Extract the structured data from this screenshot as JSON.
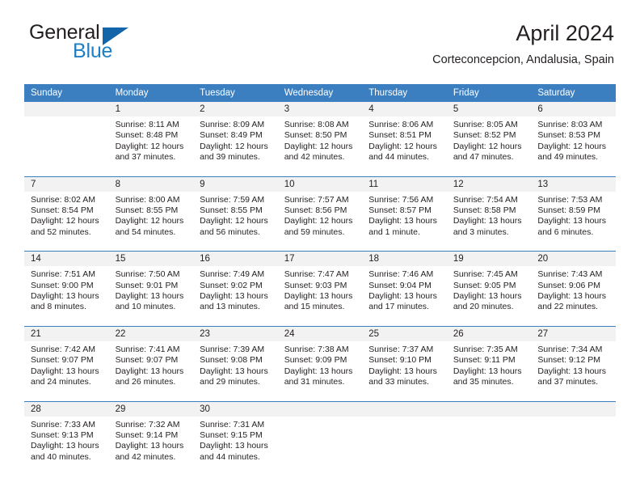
{
  "brand": {
    "name_part1": "General",
    "name_part2": "Blue",
    "triangle_color": "#1265a8",
    "blue_color": "#1f7fc4"
  },
  "header": {
    "title": "April 2024",
    "subtitle": "Corteconcepcion, Andalusia, Spain"
  },
  "theme": {
    "header_bg": "#3b7fc0",
    "daynum_bg": "#f2f2f2",
    "text": "#231f20"
  },
  "weekdays": [
    "Sunday",
    "Monday",
    "Tuesday",
    "Wednesday",
    "Thursday",
    "Friday",
    "Saturday"
  ],
  "weeks": [
    {
      "days": [
        {
          "num": "",
          "sunrise": "",
          "sunset": "",
          "daylight1": "",
          "daylight2": ""
        },
        {
          "num": "1",
          "sunrise": "Sunrise: 8:11 AM",
          "sunset": "Sunset: 8:48 PM",
          "daylight1": "Daylight: 12 hours",
          "daylight2": "and 37 minutes."
        },
        {
          "num": "2",
          "sunrise": "Sunrise: 8:09 AM",
          "sunset": "Sunset: 8:49 PM",
          "daylight1": "Daylight: 12 hours",
          "daylight2": "and 39 minutes."
        },
        {
          "num": "3",
          "sunrise": "Sunrise: 8:08 AM",
          "sunset": "Sunset: 8:50 PM",
          "daylight1": "Daylight: 12 hours",
          "daylight2": "and 42 minutes."
        },
        {
          "num": "4",
          "sunrise": "Sunrise: 8:06 AM",
          "sunset": "Sunset: 8:51 PM",
          "daylight1": "Daylight: 12 hours",
          "daylight2": "and 44 minutes."
        },
        {
          "num": "5",
          "sunrise": "Sunrise: 8:05 AM",
          "sunset": "Sunset: 8:52 PM",
          "daylight1": "Daylight: 12 hours",
          "daylight2": "and 47 minutes."
        },
        {
          "num": "6",
          "sunrise": "Sunrise: 8:03 AM",
          "sunset": "Sunset: 8:53 PM",
          "daylight1": "Daylight: 12 hours",
          "daylight2": "and 49 minutes."
        }
      ]
    },
    {
      "days": [
        {
          "num": "7",
          "sunrise": "Sunrise: 8:02 AM",
          "sunset": "Sunset: 8:54 PM",
          "daylight1": "Daylight: 12 hours",
          "daylight2": "and 52 minutes."
        },
        {
          "num": "8",
          "sunrise": "Sunrise: 8:00 AM",
          "sunset": "Sunset: 8:55 PM",
          "daylight1": "Daylight: 12 hours",
          "daylight2": "and 54 minutes."
        },
        {
          "num": "9",
          "sunrise": "Sunrise: 7:59 AM",
          "sunset": "Sunset: 8:55 PM",
          "daylight1": "Daylight: 12 hours",
          "daylight2": "and 56 minutes."
        },
        {
          "num": "10",
          "sunrise": "Sunrise: 7:57 AM",
          "sunset": "Sunset: 8:56 PM",
          "daylight1": "Daylight: 12 hours",
          "daylight2": "and 59 minutes."
        },
        {
          "num": "11",
          "sunrise": "Sunrise: 7:56 AM",
          "sunset": "Sunset: 8:57 PM",
          "daylight1": "Daylight: 13 hours",
          "daylight2": "and 1 minute."
        },
        {
          "num": "12",
          "sunrise": "Sunrise: 7:54 AM",
          "sunset": "Sunset: 8:58 PM",
          "daylight1": "Daylight: 13 hours",
          "daylight2": "and 3 minutes."
        },
        {
          "num": "13",
          "sunrise": "Sunrise: 7:53 AM",
          "sunset": "Sunset: 8:59 PM",
          "daylight1": "Daylight: 13 hours",
          "daylight2": "and 6 minutes."
        }
      ]
    },
    {
      "days": [
        {
          "num": "14",
          "sunrise": "Sunrise: 7:51 AM",
          "sunset": "Sunset: 9:00 PM",
          "daylight1": "Daylight: 13 hours",
          "daylight2": "and 8 minutes."
        },
        {
          "num": "15",
          "sunrise": "Sunrise: 7:50 AM",
          "sunset": "Sunset: 9:01 PM",
          "daylight1": "Daylight: 13 hours",
          "daylight2": "and 10 minutes."
        },
        {
          "num": "16",
          "sunrise": "Sunrise: 7:49 AM",
          "sunset": "Sunset: 9:02 PM",
          "daylight1": "Daylight: 13 hours",
          "daylight2": "and 13 minutes."
        },
        {
          "num": "17",
          "sunrise": "Sunrise: 7:47 AM",
          "sunset": "Sunset: 9:03 PM",
          "daylight1": "Daylight: 13 hours",
          "daylight2": "and 15 minutes."
        },
        {
          "num": "18",
          "sunrise": "Sunrise: 7:46 AM",
          "sunset": "Sunset: 9:04 PM",
          "daylight1": "Daylight: 13 hours",
          "daylight2": "and 17 minutes."
        },
        {
          "num": "19",
          "sunrise": "Sunrise: 7:45 AM",
          "sunset": "Sunset: 9:05 PM",
          "daylight1": "Daylight: 13 hours",
          "daylight2": "and 20 minutes."
        },
        {
          "num": "20",
          "sunrise": "Sunrise: 7:43 AM",
          "sunset": "Sunset: 9:06 PM",
          "daylight1": "Daylight: 13 hours",
          "daylight2": "and 22 minutes."
        }
      ]
    },
    {
      "days": [
        {
          "num": "21",
          "sunrise": "Sunrise: 7:42 AM",
          "sunset": "Sunset: 9:07 PM",
          "daylight1": "Daylight: 13 hours",
          "daylight2": "and 24 minutes."
        },
        {
          "num": "22",
          "sunrise": "Sunrise: 7:41 AM",
          "sunset": "Sunset: 9:07 PM",
          "daylight1": "Daylight: 13 hours",
          "daylight2": "and 26 minutes."
        },
        {
          "num": "23",
          "sunrise": "Sunrise: 7:39 AM",
          "sunset": "Sunset: 9:08 PM",
          "daylight1": "Daylight: 13 hours",
          "daylight2": "and 29 minutes."
        },
        {
          "num": "24",
          "sunrise": "Sunrise: 7:38 AM",
          "sunset": "Sunset: 9:09 PM",
          "daylight1": "Daylight: 13 hours",
          "daylight2": "and 31 minutes."
        },
        {
          "num": "25",
          "sunrise": "Sunrise: 7:37 AM",
          "sunset": "Sunset: 9:10 PM",
          "daylight1": "Daylight: 13 hours",
          "daylight2": "and 33 minutes."
        },
        {
          "num": "26",
          "sunrise": "Sunrise: 7:35 AM",
          "sunset": "Sunset: 9:11 PM",
          "daylight1": "Daylight: 13 hours",
          "daylight2": "and 35 minutes."
        },
        {
          "num": "27",
          "sunrise": "Sunrise: 7:34 AM",
          "sunset": "Sunset: 9:12 PM",
          "daylight1": "Daylight: 13 hours",
          "daylight2": "and 37 minutes."
        }
      ]
    },
    {
      "days": [
        {
          "num": "28",
          "sunrise": "Sunrise: 7:33 AM",
          "sunset": "Sunset: 9:13 PM",
          "daylight1": "Daylight: 13 hours",
          "daylight2": "and 40 minutes."
        },
        {
          "num": "29",
          "sunrise": "Sunrise: 7:32 AM",
          "sunset": "Sunset: 9:14 PM",
          "daylight1": "Daylight: 13 hours",
          "daylight2": "and 42 minutes."
        },
        {
          "num": "30",
          "sunrise": "Sunrise: 7:31 AM",
          "sunset": "Sunset: 9:15 PM",
          "daylight1": "Daylight: 13 hours",
          "daylight2": "and 44 minutes."
        },
        {
          "num": "",
          "sunrise": "",
          "sunset": "",
          "daylight1": "",
          "daylight2": ""
        },
        {
          "num": "",
          "sunrise": "",
          "sunset": "",
          "daylight1": "",
          "daylight2": ""
        },
        {
          "num": "",
          "sunrise": "",
          "sunset": "",
          "daylight1": "",
          "daylight2": ""
        },
        {
          "num": "",
          "sunrise": "",
          "sunset": "",
          "daylight1": "",
          "daylight2": ""
        }
      ]
    }
  ]
}
